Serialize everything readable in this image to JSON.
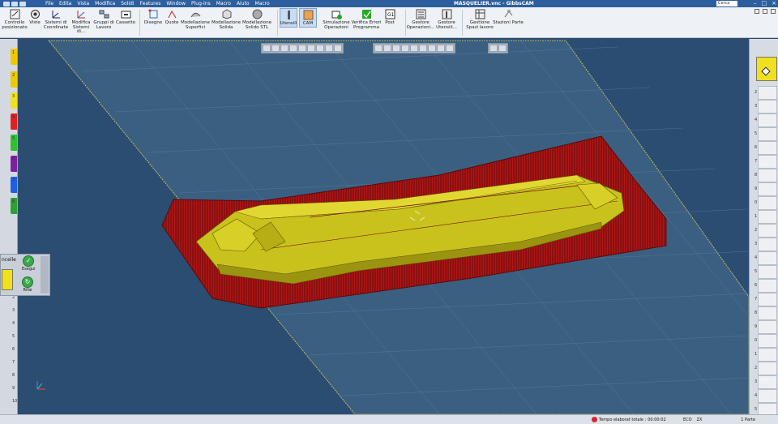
{
  "titlebar": {
    "menus": [
      "File",
      "Edita",
      "Vista",
      "Modifica",
      "Solidi",
      "Features",
      "Window",
      "Plug-Ins",
      "Macro",
      "Aiuto",
      "Macro"
    ],
    "app_title": "MASQUELIER.vnc - GibbsCAM",
    "search_placeholder": "Cerca"
  },
  "ribbon": {
    "buttons": [
      {
        "label1": "Controllo",
        "label2": "posizionato"
      },
      {
        "label1": "Viste",
        "label2": ""
      },
      {
        "label1": "Sistemi di",
        "label2": "Coordinate"
      },
      {
        "label1": "Modifica",
        "label2": "Sistemi di..."
      },
      {
        "label1": "Gruppi di",
        "label2": "Lavoro"
      },
      {
        "label1": "Cassetto",
        "label2": ""
      },
      {
        "label1": "Disegno",
        "label2": ""
      },
      {
        "label1": "Quote",
        "label2": ""
      },
      {
        "label1": "Modellazione",
        "label2": "Superfici"
      },
      {
        "label1": "Modellazione",
        "label2": "Solida"
      },
      {
        "label1": "Modellazione",
        "label2": "Solido STL"
      },
      {
        "label1": "Utensili",
        "label2": ""
      },
      {
        "label1": "CAM",
        "label2": ""
      },
      {
        "label1": "Simulazione",
        "label2": "Operazioni"
      },
      {
        "label1": "Verifica Errori",
        "label2": "Programma"
      },
      {
        "label1": "Post",
        "label2": ""
      },
      {
        "label1": "Gestore",
        "label2": "Operazioni..."
      },
      {
        "label1": "Gestore",
        "label2": "Utensili..."
      },
      {
        "label1": "Gestione",
        "label2": "Spazi lavoro"
      },
      {
        "label1": "Stazioni Parte",
        "label2": ""
      }
    ]
  },
  "left_panel": {
    "tab_numbers": [
      "1",
      "2",
      "3",
      "4",
      "5",
      "6",
      "7",
      "8"
    ],
    "tab_colors": [
      "#f0c800",
      "#f0c800",
      "#f0e020",
      "#e02020",
      "#30c030",
      "#8020a0",
      "#2060e0",
      "#30a030"
    ],
    "panel_label": "ncelle",
    "run_button": "Esegui",
    "redo_button": "Rifai",
    "lower_numbers": [
      "2",
      "3",
      "4",
      "5",
      "6",
      "7",
      "8",
      "9",
      "10"
    ]
  },
  "right_panel": {
    "numbers": [
      "2",
      "3",
      "4",
      "5",
      "6",
      "7",
      "8",
      "9",
      "0",
      "1",
      "2",
      "3",
      "4",
      "5",
      "6",
      "7",
      "8",
      "9",
      "0",
      "1",
      "2",
      "3",
      "4",
      "5"
    ]
  },
  "statusbar": {
    "elapsed_label": "Tempo elaborat totale :",
    "elapsed_value": "00:00:02",
    "unit_a": "ECO",
    "unit_b": "ZX",
    "parts": "1 Parte"
  },
  "colors": {
    "viewport_bg": "#2c4d72",
    "part_fill": "#c8c21a",
    "toolpath": "#8c1010",
    "grid_line": "#e0d84a"
  }
}
